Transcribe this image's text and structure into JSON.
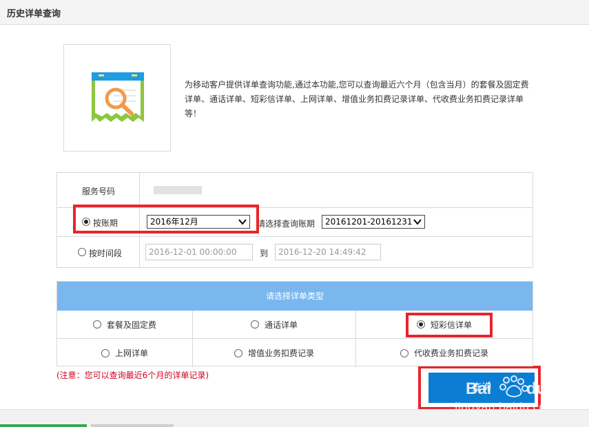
{
  "page": {
    "title": "历史详单查询"
  },
  "intro": {
    "description": "为移动客户提供详单查询功能,通过本功能,您可以查询最近六个月（包含当月）的套餐及固定费详单、通话详单、短彩信详单、上网详单、增值业务扣费记录详单、代收费业务扣费记录详单等！"
  },
  "form": {
    "service_number_label": "服务号码",
    "by_period_label": "按账期",
    "period_value": "2016年12月",
    "select_period_label": "请选择查询账期",
    "period_range_value": "20161201-20161231",
    "by_time_label": "按时间段",
    "start_time": "2016-12-01 00:00:00",
    "to_label": "到",
    "end_time": "2016-12-20 14:49:42"
  },
  "types": {
    "header": "请选择详单类型",
    "items": [
      {
        "label": "套餐及固定费",
        "checked": false
      },
      {
        "label": "通话详单",
        "checked": false
      },
      {
        "label": "短彩信详单",
        "checked": true
      },
      {
        "label": "上网详单",
        "checked": false
      },
      {
        "label": "增值业务扣费记录",
        "checked": false
      },
      {
        "label": "代收费业务扣费记录",
        "checked": false
      }
    ]
  },
  "note": "(注意：您可以查询最近6个月的详单记录)",
  "query_button": "查询",
  "watermark": {
    "brand": "Baidu经验",
    "url": "jingyan.baidu.com"
  },
  "colors": {
    "header_bar": "#7ab7ef",
    "button": "#0b7ed3",
    "highlight": "#e8252b",
    "note": "#d0021b"
  }
}
